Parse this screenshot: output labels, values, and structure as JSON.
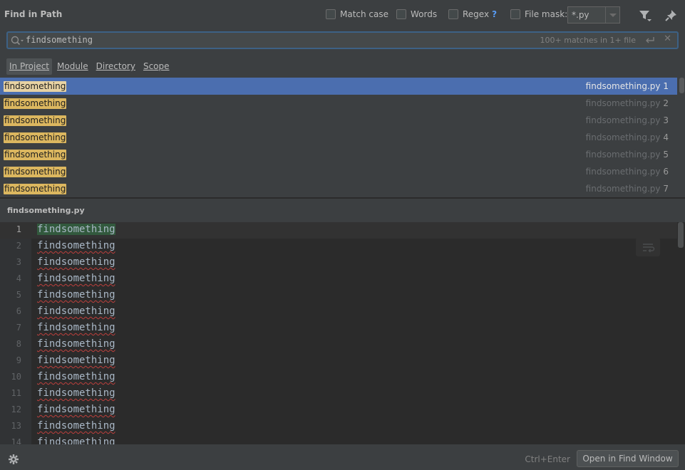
{
  "header": {
    "title": "Find in Path",
    "options": {
      "match_case": {
        "label": "Match case",
        "checked": false
      },
      "words": {
        "label": "Words",
        "checked": false
      },
      "regex": {
        "label": "Regex",
        "help": "?",
        "checked": false
      },
      "file_mask": {
        "label": "File mask:",
        "checked": false,
        "value": "*.py"
      }
    },
    "icons": [
      "filter-icon",
      "pin-icon"
    ]
  },
  "search": {
    "value": "findsomething",
    "info": "100+ matches in 1+ file",
    "icons": [
      "search-icon",
      "newline-icon",
      "close-icon"
    ]
  },
  "scopes": [
    {
      "label": "In Project",
      "active": true
    },
    {
      "label": "Module",
      "active": false
    },
    {
      "label": "Directory",
      "active": false
    },
    {
      "label": "Scope",
      "active": false
    }
  ],
  "results": [
    {
      "text": "findsomething",
      "file": "findsomething.py",
      "line": "1",
      "selected": true
    },
    {
      "text": "findsomething",
      "file": "findsomething.py",
      "line": "2",
      "selected": false
    },
    {
      "text": "findsomething",
      "file": "findsomething.py",
      "line": "3",
      "selected": false
    },
    {
      "text": "findsomething",
      "file": "findsomething.py",
      "line": "4",
      "selected": false
    },
    {
      "text": "findsomething",
      "file": "findsomething.py",
      "line": "5",
      "selected": false
    },
    {
      "text": "findsomething",
      "file": "findsomething.py",
      "line": "6",
      "selected": false
    },
    {
      "text": "findsomething",
      "file": "findsomething.py",
      "line": "7",
      "selected": false
    }
  ],
  "preview": {
    "file_name": "findsomething.py",
    "lines": [
      {
        "num": "1",
        "text": "findsomething"
      },
      {
        "num": "2",
        "text": "findsomething"
      },
      {
        "num": "3",
        "text": "findsomething"
      },
      {
        "num": "4",
        "text": "findsomething"
      },
      {
        "num": "5",
        "text": "findsomething"
      },
      {
        "num": "6",
        "text": "findsomething"
      },
      {
        "num": "7",
        "text": "findsomething"
      },
      {
        "num": "8",
        "text": "findsomething"
      },
      {
        "num": "9",
        "text": "findsomething"
      },
      {
        "num": "10",
        "text": "findsomething"
      },
      {
        "num": "11",
        "text": "findsomething"
      },
      {
        "num": "12",
        "text": "findsomething"
      },
      {
        "num": "13",
        "text": "findsomething"
      },
      {
        "num": "14",
        "text": "findsomething"
      }
    ]
  },
  "footer": {
    "shortcut": "Ctrl+Enter",
    "open_button": "Open in Find Window",
    "icons": [
      "gear-icon"
    ]
  },
  "colors": {
    "background": "#3c3f41",
    "editor_background": "#2b2b2b",
    "selection": "#4b6eaf",
    "match_highlight": "#dcb75f",
    "focus_border": "#3d6185",
    "current_match": "#32593d"
  }
}
